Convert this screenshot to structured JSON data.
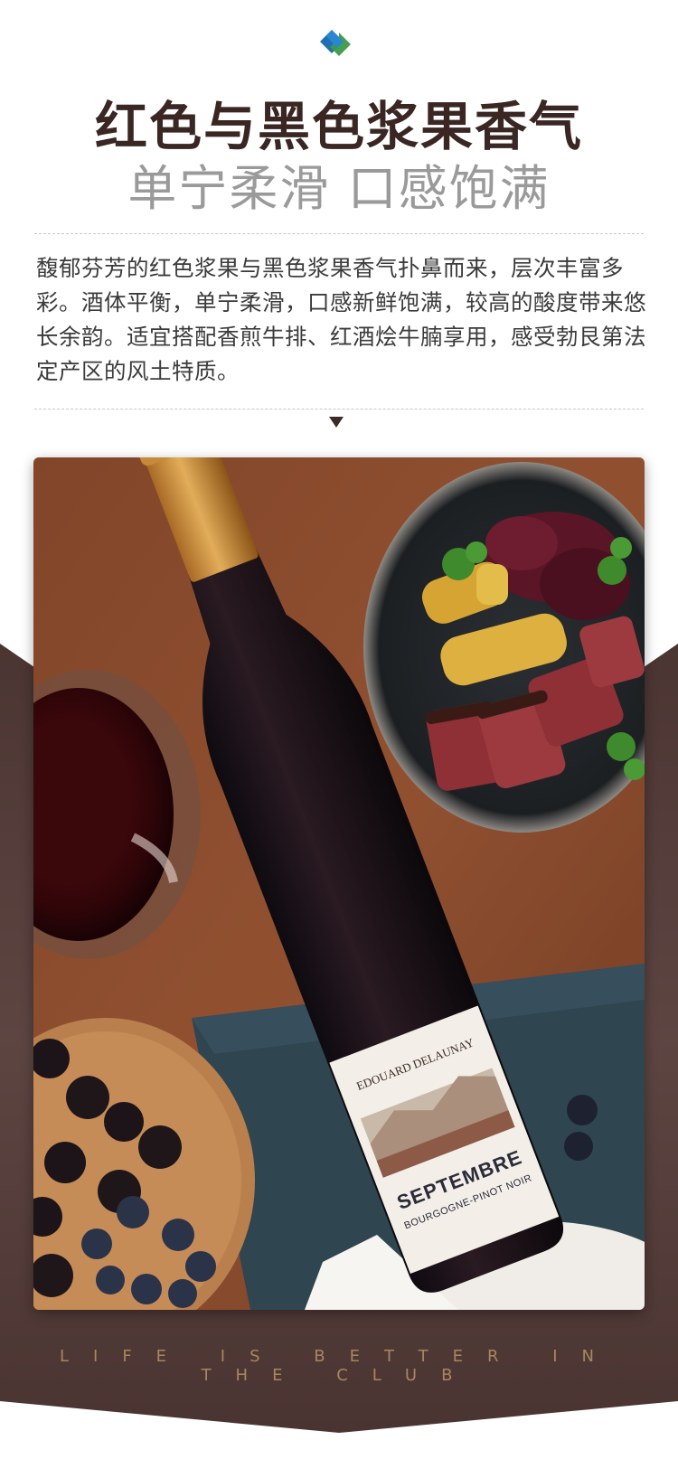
{
  "header": {
    "logo_icon": "diamond-logo-icon",
    "title": "红色与黑色浆果香气",
    "subtitle": "单宁柔滑 口感饱满"
  },
  "description": "馥郁芬芳的红色浆果与黑色浆果香气扑鼻而来，层次丰富多彩。酒体平衡，单宁柔滑，口感新鲜饱满，较高的酸度带来悠长余韵。适宜搭配香煎牛排、红酒烩牛腩享用，感受勃艮第法定产区的风土特质。",
  "photo": {
    "bottle_brand": "EDOUARD DELAUNAY",
    "bottle_name": "SEPTEMBRE",
    "bottle_appellation": "BOURGOGNE-PINOT NOIR"
  },
  "footer": {
    "tagline": "LIFE IS BETTER IN THE CLUB"
  },
  "colors": {
    "band_top": "#4b3532",
    "band_bottom": "#5b4441",
    "title": "#3a2622",
    "tagline": "#a7875c"
  }
}
